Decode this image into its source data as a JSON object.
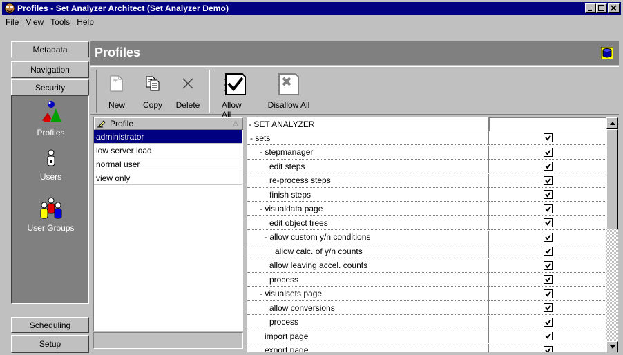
{
  "window": {
    "title": "Profiles - Set Analyzer Architect (Set Analyzer Demo)"
  },
  "menu": {
    "items": [
      {
        "label": "File",
        "accel": "F",
        "rest": "ile"
      },
      {
        "label": "View",
        "accel": "V",
        "rest": "iew"
      },
      {
        "label": "Tools",
        "accel": "T",
        "rest": "ools"
      },
      {
        "label": "Help",
        "accel": "H",
        "rest": "elp"
      }
    ]
  },
  "leftnav": {
    "top_buttons": [
      "Metadata",
      "Navigation",
      "Security"
    ],
    "bottom_buttons": [
      "Scheduling",
      "Setup"
    ],
    "items": [
      {
        "label": "Profiles",
        "icon": "profiles-icon"
      },
      {
        "label": "Users",
        "icon": "user-icon"
      },
      {
        "label": "User Groups",
        "icon": "user-groups-icon"
      }
    ]
  },
  "header": {
    "title": "Profiles",
    "icon": "database-icon"
  },
  "toolbar": {
    "new_label": "New",
    "copy_label": "Copy",
    "delete_label": "Delete",
    "allow_all_label": "Allow All",
    "disallow_all_label": "Disallow All"
  },
  "profiles": {
    "column_header": "Profile",
    "rows": [
      "administrator",
      "low server load",
      "normal user",
      "view only"
    ],
    "selected": "administrator"
  },
  "permissions": {
    "root": "- SET ANALYZER",
    "rows": [
      {
        "label": "- sets",
        "checked": true
      },
      {
        "label": "- stepmanager",
        "checked": true
      },
      {
        "label": "edit steps",
        "checked": true
      },
      {
        "label": "re-process steps",
        "checked": true
      },
      {
        "label": "finish steps",
        "checked": true
      },
      {
        "label": "- visualdata page",
        "checked": true
      },
      {
        "label": "edit object trees",
        "checked": true
      },
      {
        "label": "- allow custom y/n conditions",
        "checked": true
      },
      {
        "label": "allow calc. of y/n counts",
        "checked": true
      },
      {
        "label": "allow leaving accel. counts",
        "checked": true
      },
      {
        "label": "process",
        "checked": true
      },
      {
        "label": "- visualsets page",
        "checked": true
      },
      {
        "label": "allow conversions",
        "checked": true
      },
      {
        "label": "process",
        "checked": true
      },
      {
        "label": "import page",
        "checked": true
      },
      {
        "label": "export page",
        "checked": true
      }
    ]
  },
  "colors": {
    "titlebar": "#000080",
    "selection": "#000080",
    "panel_gray": "#808080",
    "face": "#c0c0c0"
  }
}
